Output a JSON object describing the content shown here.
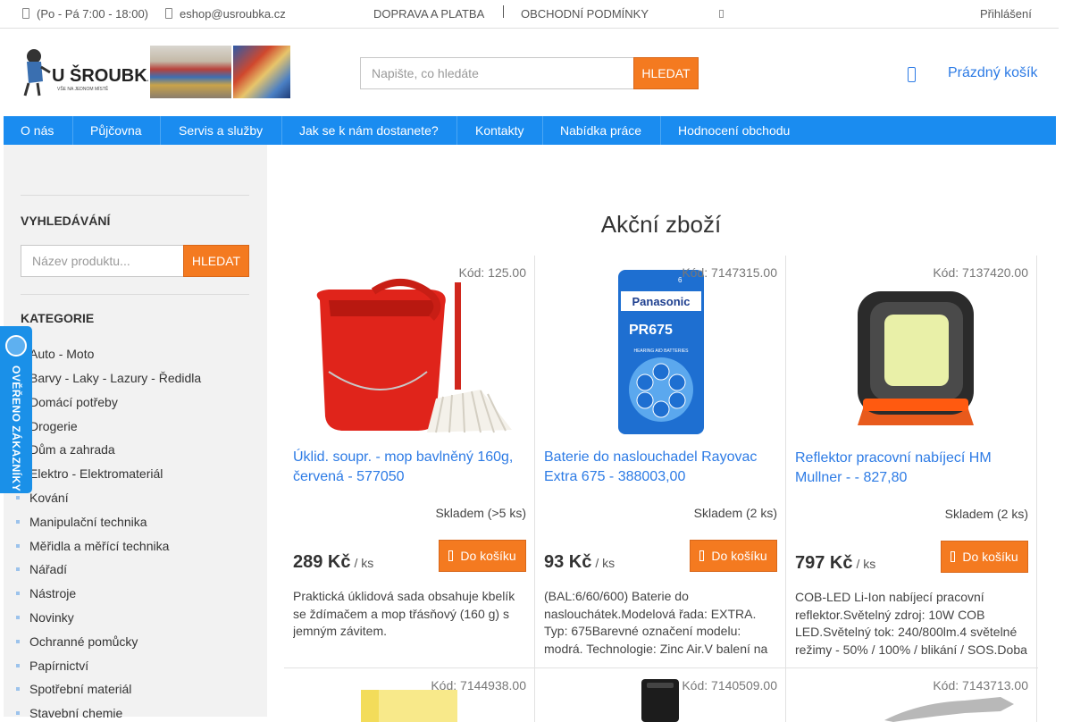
{
  "topbar": {
    "phone": "(Po - Pá 7:00 - 18:00)",
    "email": "eshop@usroubka.cz",
    "links": [
      "DOPRAVA A PLATBA",
      "OBCHODNÍ PODMÍNKY"
    ],
    "login": "Přihlášení"
  },
  "header": {
    "logo_text": "U ŠROUBKA",
    "logo_tagline": "VŠE NA JEDNOM MÍSTĚ",
    "search_placeholder": "Napište, co hledáte",
    "search_button": "HLEDAT",
    "cart_label": "Prázdný košík"
  },
  "nav": {
    "items": [
      "O nás",
      "Půjčovna",
      "Servis a služby",
      "Jak se k nám dostanete?",
      "Kontakty",
      "Nabídka práce",
      "Hodnocení obchodu"
    ]
  },
  "sidebar": {
    "search_heading": "VYHLEDÁVÁNÍ",
    "search_placeholder": "Název produktu...",
    "search_button": "HLEDAT",
    "categories_heading": "KATEGORIE",
    "categories": [
      "Auto - Moto",
      "Barvy - Laky - Lazury - Ředidla",
      "Domácí potřeby",
      "Drogerie",
      "Dům a zahrada",
      "Elektro - Elektromateriál",
      "Kování",
      "Manipulační technika",
      "Měřidla a měřící technika",
      "Nářadí",
      "Nástroje",
      "Novinky",
      "Ochranné pomůcky",
      "Papírnictví",
      "Spotřební materiál",
      "Stavební chemie"
    ]
  },
  "badge": {
    "text": "OVĚŘENO ZÁKAZNÍKY"
  },
  "main": {
    "title": "Akční zboží",
    "add_to_cart": "Do košíku",
    "unit": "/ ks",
    "products": [
      {
        "code": "Kód: 125.00",
        "name": "Úklid. soupr. - mop bavlněný 160g, červená - 577050",
        "stock": "Skladem (>5 ks)",
        "price": "289 Kč",
        "description": "Praktická úklidová sada obsahuje kbelík se ždímačem a mop třásňový (160 g) s jemným závitem."
      },
      {
        "code": "Kód: 7147315.00",
        "name": "Baterie do naslouchadel Rayovac Extra 675 - 388003,00",
        "stock": "Skladem (2 ks)",
        "price": "93 Kč",
        "description": "(BAL:6/60/600) Baterie do naslouchátek.Modelová řada: EXTRA. Typ: 675Barevné označení modelu: modrá. Technologie: Zinc Air.V balení na"
      },
      {
        "code": "Kód: 7137420.00",
        "name": "Reflektor pracovní nabíjecí HM Mullner - - 827,80",
        "stock": "Skladem (2 ks)",
        "price": "797 Kč",
        "description": "COB-LED Li-Ion nabíjecí pracovní reflektor.Světelný zdroj: 10W COB LED.Světelný tok: 240/800lm.4 světelné režimy - 50% / 100% / blikání / SOS.Doba"
      }
    ],
    "products_row2": [
      {
        "code": "Kód: 7144938.00"
      },
      {
        "code": "Kód: 7140509.00"
      },
      {
        "code": "Kód: 7143713.00"
      }
    ],
    "battery_pack": {
      "brand": "Panasonic",
      "model": "PR675",
      "subtitle": "HEARING AID BATTERIES",
      "count": "6"
    }
  }
}
